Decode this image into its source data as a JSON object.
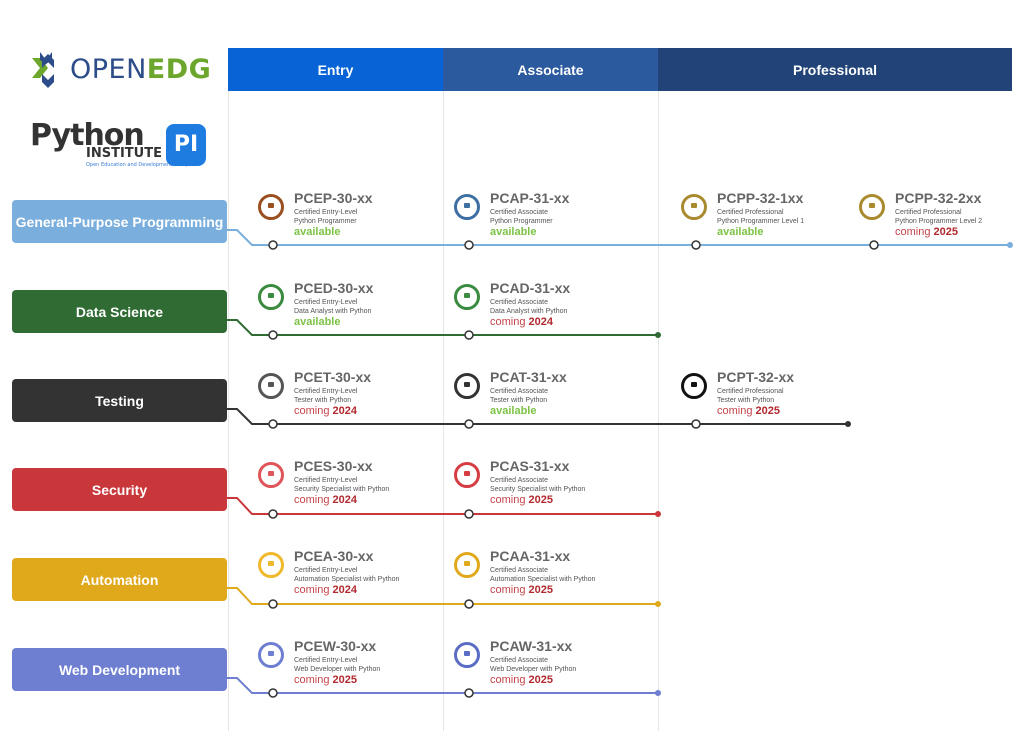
{
  "logos": {
    "openedg": {
      "open": "OPEN",
      "edg": "EDG"
    },
    "python_institute": {
      "python": "Python",
      "institute": "INSTITUTE",
      "tagline": "Open Education and Development Group",
      "badge": "PI"
    }
  },
  "levels": [
    {
      "label": "Entry",
      "color": "#0763d6"
    },
    {
      "label": "Associate",
      "color": "#2b5a9e"
    },
    {
      "label": "Professional",
      "color": "#214377"
    }
  ],
  "tracks": [
    {
      "label": "General-Purpose Programming",
      "color": "#7aaedd",
      "certs": [
        {
          "code": "PCEP-30-xx",
          "line1": "Certified Entry-Level",
          "line2": "Python Programmer",
          "status": "available",
          "badge_color": "#9a4f1f"
        },
        {
          "code": "PCAP-31-xx",
          "line1": "Certified Associate",
          "line2": "Python Programmer",
          "status": "available",
          "badge_color": "#3d6fa3"
        },
        {
          "code": "PCPP-32-1xx",
          "line1": "Certified Professional",
          "line2": "Python Programmer Level 1",
          "status": "available",
          "badge_color": "#a98a2e"
        },
        {
          "code": "PCPP-32-2xx",
          "line1": "Certified Professional",
          "line2": "Python Programmer Level 2",
          "status": "coming",
          "year": "2025",
          "badge_color": "#a98a2e"
        }
      ]
    },
    {
      "label": "Data Science",
      "color": "#2f6b32",
      "certs": [
        {
          "code": "PCED-30-xx",
          "line1": "Certified Entry-Level",
          "line2": "Data Analyst with Python",
          "status": "available",
          "badge_color": "#3a8a3f"
        },
        {
          "code": "PCAD-31-xx",
          "line1": "Certified Associate",
          "line2": "Data Analyst with Python",
          "status": "coming",
          "year": "2024",
          "badge_color": "#3a8a3f"
        }
      ]
    },
    {
      "label": "Testing",
      "color": "#333333",
      "certs": [
        {
          "code": "PCET-30-xx",
          "line1": "Certified Entry-Level",
          "line2": "Tester with Python",
          "status": "coming",
          "year": "2024",
          "badge_color": "#555555"
        },
        {
          "code": "PCAT-31-xx",
          "line1": "Certified Associate",
          "line2": "Tester with Python",
          "status": "available",
          "badge_color": "#333333"
        },
        {
          "code": "PCPT-32-xx",
          "line1": "Certified Professional",
          "line2": "Tester with Python",
          "status": "coming",
          "year": "2025",
          "badge_color": "#111111"
        }
      ]
    },
    {
      "label": "Security",
      "color": "#c9373b",
      "certs": [
        {
          "code": "PCES-30-xx",
          "line1": "Certified Entry-Level",
          "line2": "Security Specialist with Python",
          "status": "coming",
          "year": "2024",
          "badge_color": "#e0555a"
        },
        {
          "code": "PCAS-31-xx",
          "line1": "Certified Associate",
          "line2": "Security Specialist with Python",
          "status": "coming",
          "year": "2025",
          "badge_color": "#d63c42"
        }
      ]
    },
    {
      "label": "Automation",
      "color": "#e0a91c",
      "certs": [
        {
          "code": "PCEA-30-xx",
          "line1": "Certified Entry-Level",
          "line2": "Automation Specialist with Python",
          "status": "coming",
          "year": "2024",
          "badge_color": "#f0b92c"
        },
        {
          "code": "PCAA-31-xx",
          "line1": "Certified Associate",
          "line2": "Automation Specialist with Python",
          "status": "coming",
          "year": "2025",
          "badge_color": "#e0a91c"
        }
      ]
    },
    {
      "label": "Web Development",
      "color": "#6e7fd1",
      "certs": [
        {
          "code": "PCEW-30-xx",
          "line1": "Certified Entry-Level",
          "line2": "Web Developer with Python",
          "status": "coming",
          "year": "2025",
          "badge_color": "#6e7fd1"
        },
        {
          "code": "PCAW-31-xx",
          "line1": "Certified Associate",
          "line2": "Web Developer with Python",
          "status": "coming",
          "year": "2025",
          "badge_color": "#5a6cc4"
        }
      ]
    }
  ],
  "status_text": {
    "available": "available",
    "coming": "coming"
  }
}
